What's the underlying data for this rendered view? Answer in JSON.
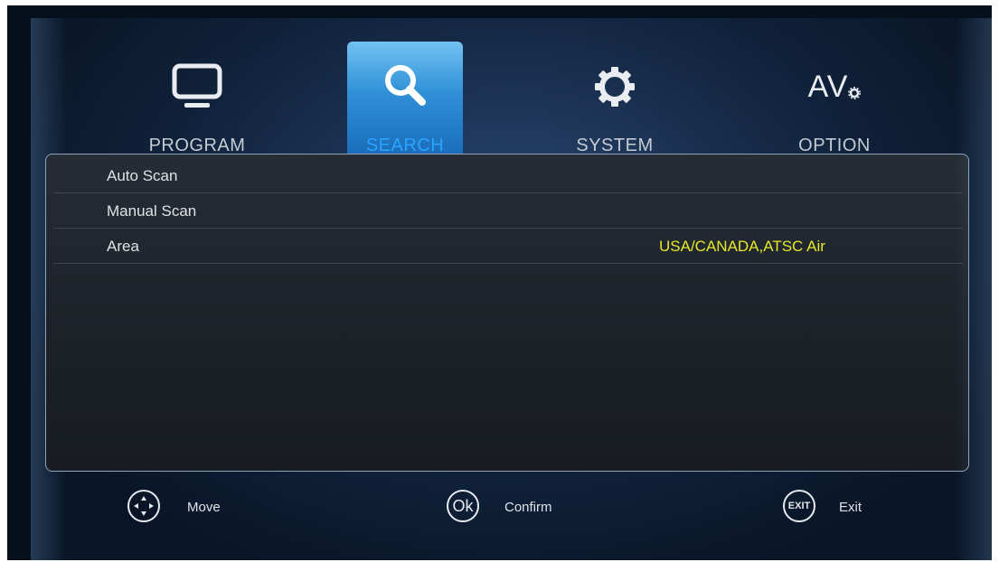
{
  "tabs": [
    {
      "label": "PROGRAM",
      "icon": "tv-monitor-icon"
    },
    {
      "label": "SEARCH",
      "icon": "magnifier-icon",
      "active": true
    },
    {
      "label": "SYSTEM",
      "icon": "gear-icon"
    },
    {
      "label": "OPTION",
      "icon": "av-settings-icon",
      "icon_text": "AV"
    }
  ],
  "menu": [
    {
      "label": "Auto Scan",
      "value": ""
    },
    {
      "label": "Manual Scan",
      "value": ""
    },
    {
      "label": "Area",
      "value": "USA/CANADA,ATSC Air"
    }
  ],
  "footer": {
    "move_label": "Move",
    "confirm_label": "Confirm",
    "ok_icon_text": "Ok",
    "exit_label": "Exit",
    "exit_icon_text": "EXIT"
  },
  "colors": {
    "active_tab": "#2f8fd6",
    "active_label": "#2aa3ff",
    "value_text": "#e6e62a",
    "panel_border": "#8fa4bc"
  }
}
